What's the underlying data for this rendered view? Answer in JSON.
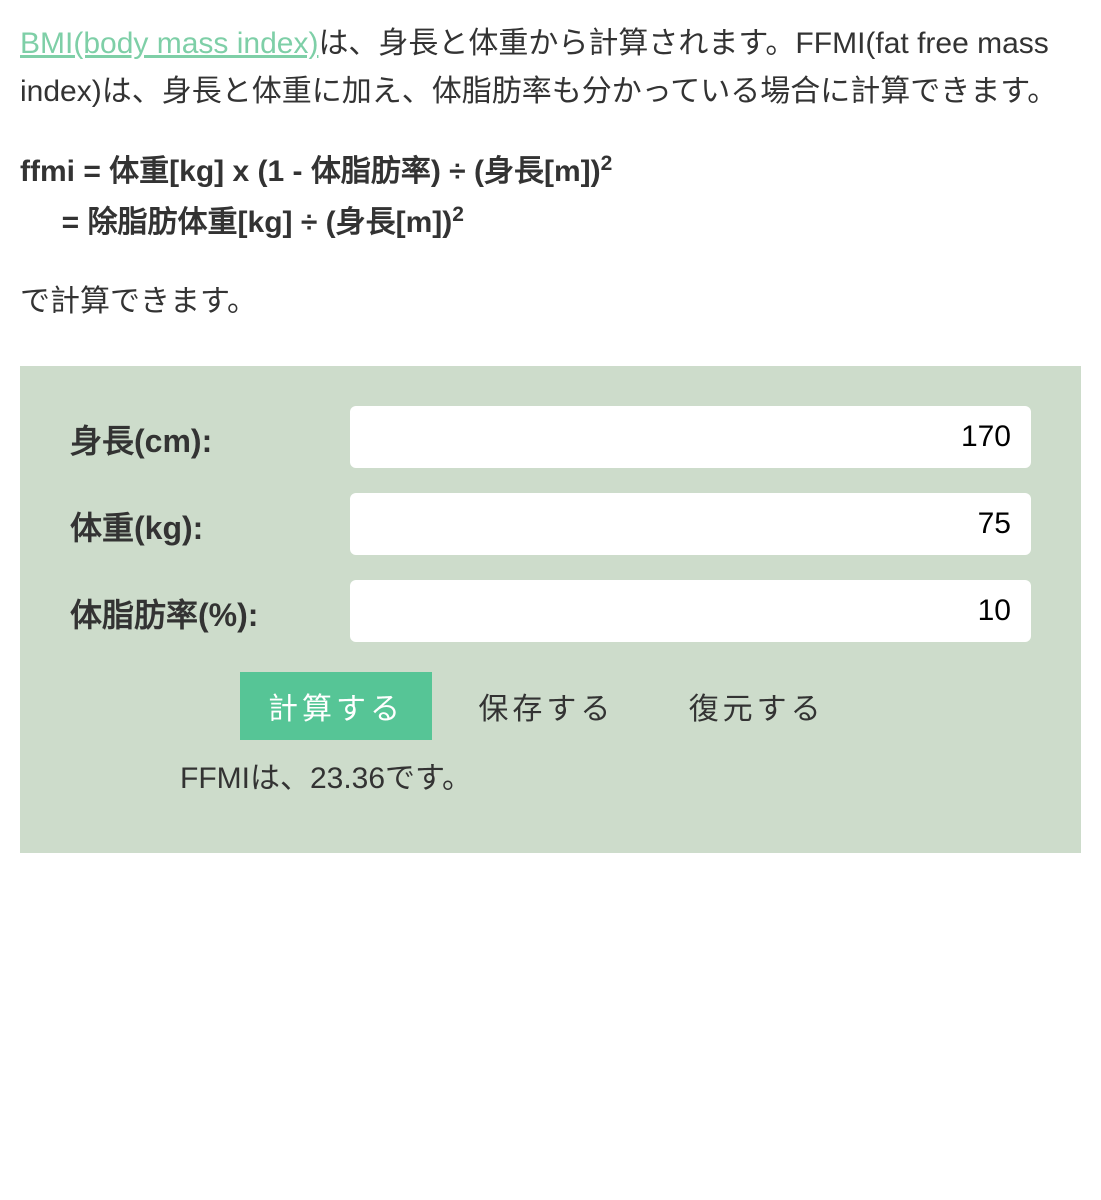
{
  "intro": {
    "link_text": "BMI(body mass index)",
    "rest": "は、身長と体重から計算されます。FFMI(fat free mass index)は、身長と体重に加え、体脂肪率も分かっている場合に計算できます。"
  },
  "formula": {
    "line1_pre": "ffmi = 体重[kg] x (1 - 体脂肪率) ÷ (身長[m])",
    "line2_pre": "     = 除脂肪体重[kg] ÷ (身長[m])",
    "sup": "2"
  },
  "desc2": "で計算できます。",
  "form": {
    "height": {
      "label": "身長(cm):",
      "value": "170"
    },
    "weight": {
      "label": "体重(kg):",
      "value": "75"
    },
    "bodyfat": {
      "label": "体脂肪率(%):",
      "value": "10"
    }
  },
  "buttons": {
    "calculate": "計算する",
    "save": "保存する",
    "restore": "復元する"
  },
  "result_text": "FFMIは、23.36です。"
}
